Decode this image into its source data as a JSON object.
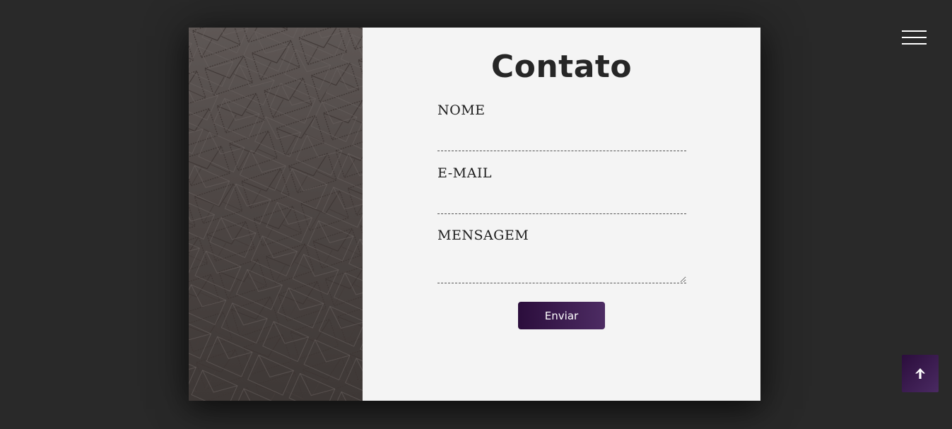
{
  "contact": {
    "title": "Contato",
    "fields": {
      "nome": {
        "label": "NOME",
        "value": ""
      },
      "email": {
        "label": "E-MAIL",
        "value": ""
      },
      "mensagem": {
        "label": "MENSAGEM",
        "value": ""
      }
    },
    "submit_label": "Enviar"
  },
  "nav": {
    "menu_icon": "hamburger-menu-icon",
    "scroll_top_icon": "arrow-up-icon"
  },
  "colors": {
    "background": "#292929",
    "panel": "#f4f4f4",
    "accent_start": "#2b0d3c",
    "accent_end": "#4d2c63",
    "title": "#262626"
  }
}
